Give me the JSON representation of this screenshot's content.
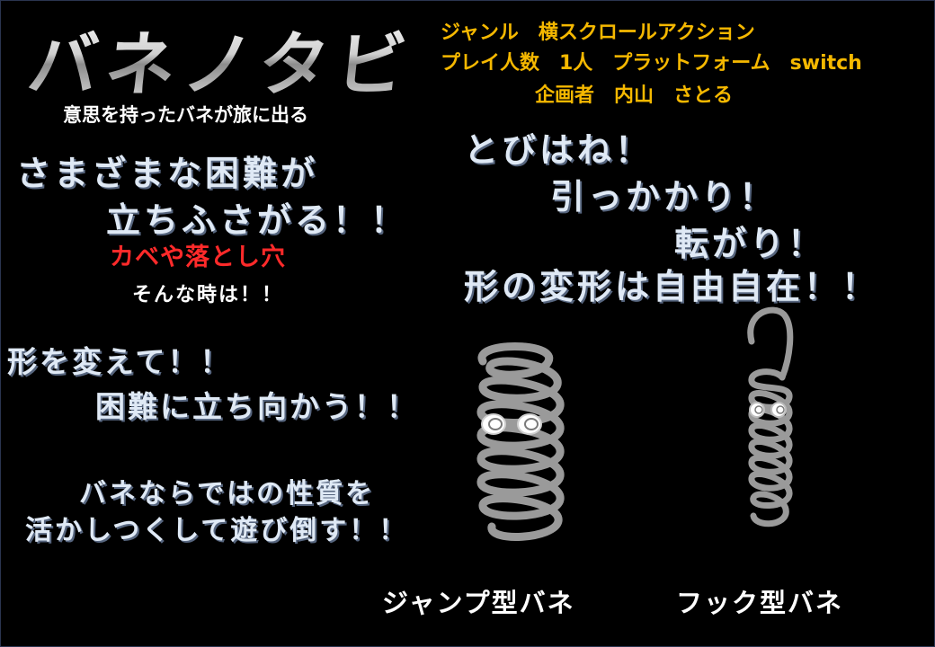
{
  "title": "バネノタビ",
  "tagline": "意思を持ったバネが旅に出る",
  "info": {
    "line1": "ジャンル　横スクロールアクション",
    "line2": "プレイ人数　1人　プラットフォーム　switch",
    "line3": "企画者　内山　さとる"
  },
  "left_block": {
    "line1": "さまざまな困難が",
    "line2": "立ちふさがる！！",
    "red": "カベや落とし穴",
    "small": "そんな時は！！"
  },
  "right_block": {
    "line1": "とびはね！",
    "line2": "引っかかり！",
    "line3": "転がり！",
    "line4": "形の変形は自由自在！！"
  },
  "middle_block": {
    "line1": "形を変えて！！",
    "line2": "困難に立ち向かう！！"
  },
  "bottom_block": {
    "line1": "バネならではの性質を",
    "line2": "活かしつくして遊び倒す！！"
  },
  "springs": {
    "jump_label": "ジャンプ型バネ",
    "hook_label": "フック型バネ",
    "spring_color": "#9a9a9a",
    "eye_color": "#ffffff"
  }
}
